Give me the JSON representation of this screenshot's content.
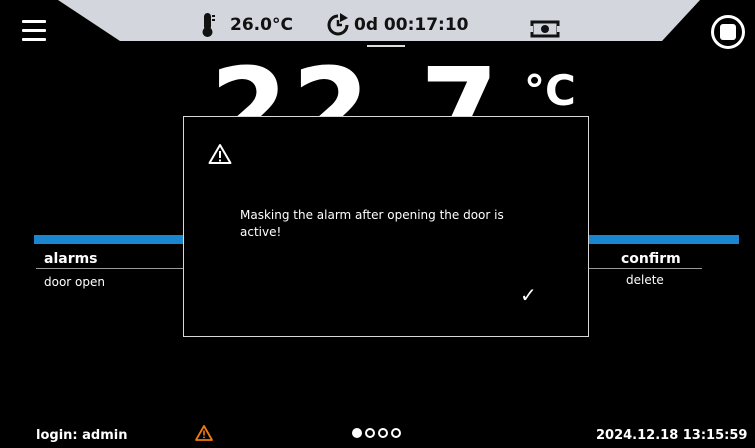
{
  "colors": {
    "accent": "#1a86d0",
    "header": "#d3d6dc",
    "warning": "#f07a0f"
  },
  "header": {
    "temperature": "26.0°C",
    "timer": "0d 00:17:10",
    "icons": [
      "menu-icon",
      "thermometer-icon",
      "clock-icon",
      "camera-icon",
      "stop-icon"
    ]
  },
  "main": {
    "temperature_display": "22.7",
    "unit": "°C"
  },
  "left_panel": {
    "title": "alarms",
    "item": "door open"
  },
  "right_panel": {
    "title": "confirm",
    "item": "delete"
  },
  "dialog": {
    "message": "Masking the alarm after opening the door is active!",
    "icon": "warning-icon",
    "confirm_icon": "checkmark-icon",
    "confirm_glyph": "✓"
  },
  "footer": {
    "login": "login: admin",
    "page_indicator": {
      "total": 4,
      "active": 1
    },
    "datetime": "2024.12.18  13:15:59"
  }
}
